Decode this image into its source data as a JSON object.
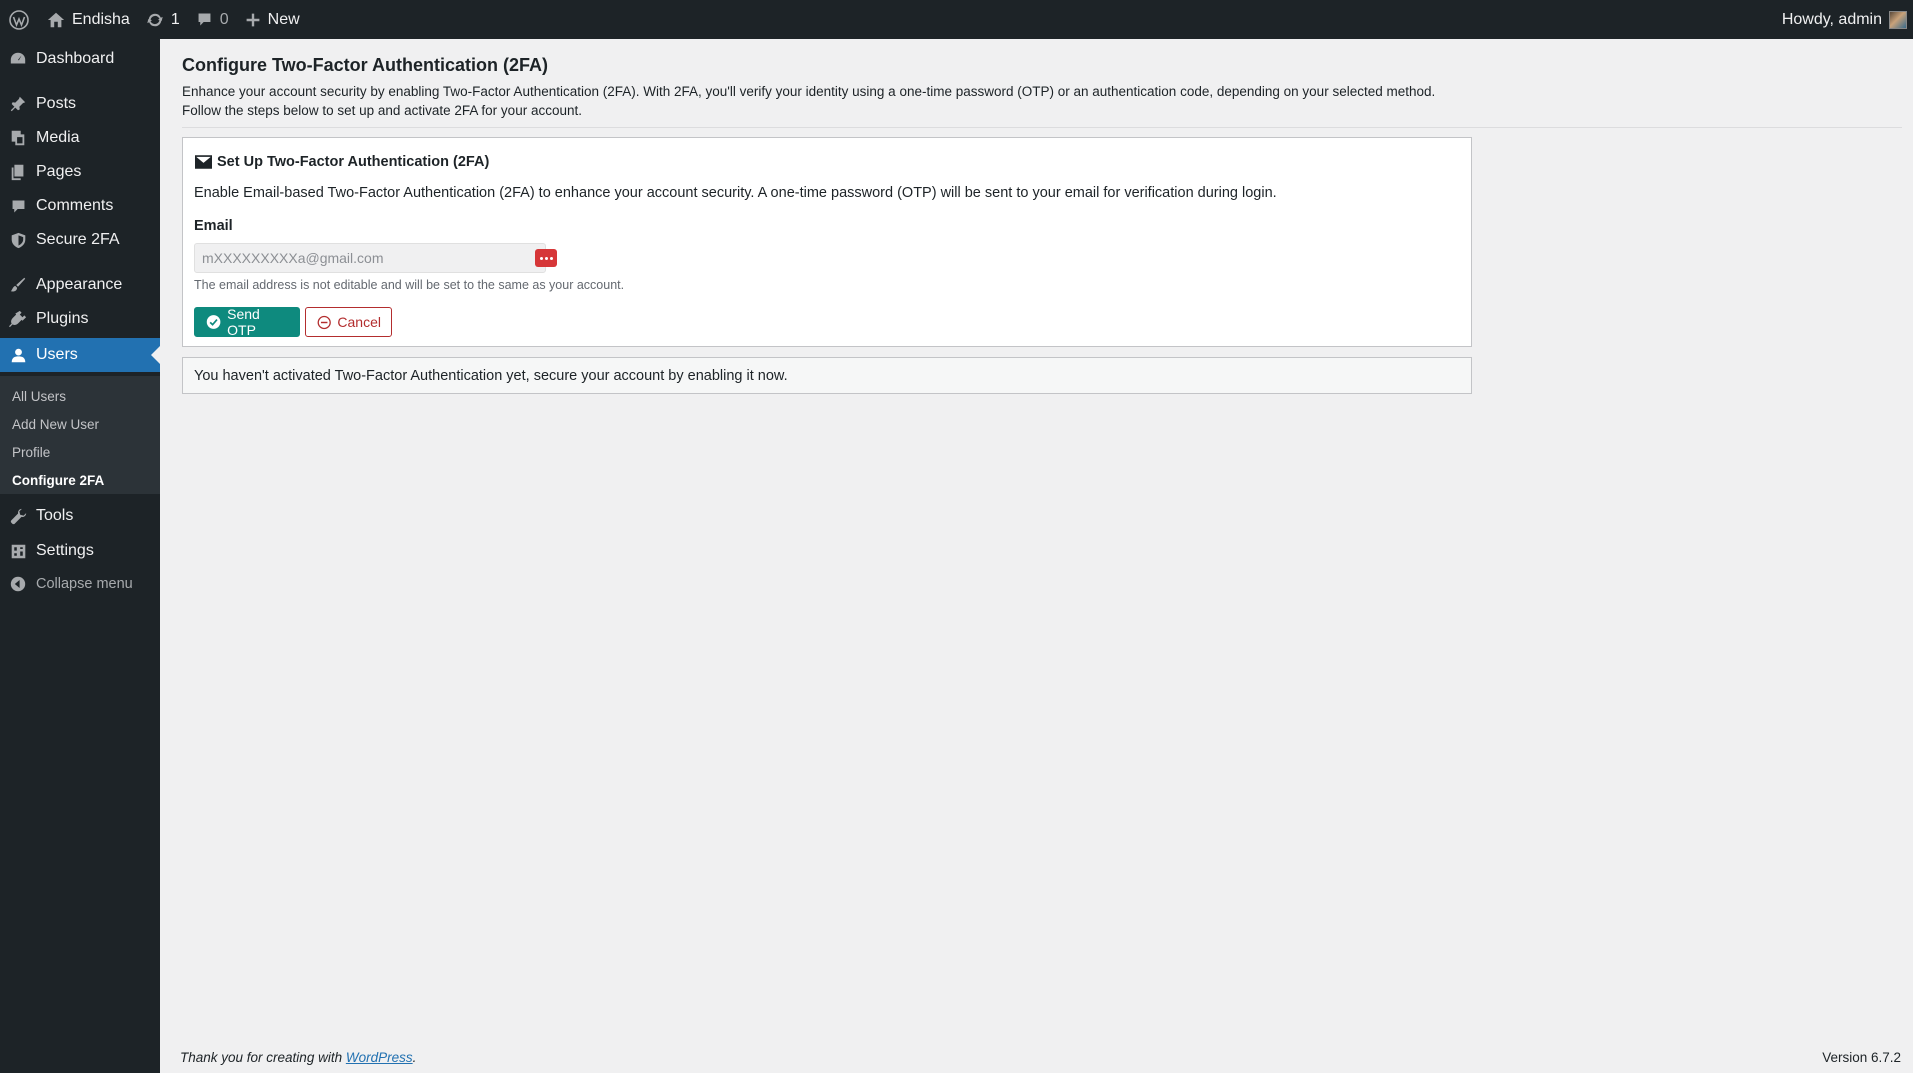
{
  "admin_bar": {
    "site_name": "Endisha",
    "updates_count": "1",
    "comments_count": "0",
    "new_label": "New",
    "greeting": "Howdy, admin"
  },
  "sidebar": {
    "items": [
      {
        "label": "Dashboard",
        "icon": "dashboard-icon"
      },
      {
        "label": "Posts",
        "icon": "pin-icon"
      },
      {
        "label": "Media",
        "icon": "media-icon"
      },
      {
        "label": "Pages",
        "icon": "pages-icon"
      },
      {
        "label": "Comments",
        "icon": "comment-icon"
      },
      {
        "label": "Secure 2FA",
        "icon": "shield-icon"
      },
      {
        "label": "Appearance",
        "icon": "brush-icon"
      },
      {
        "label": "Plugins",
        "icon": "plug-icon"
      },
      {
        "label": "Users",
        "icon": "user-icon"
      },
      {
        "label": "Tools",
        "icon": "wrench-icon"
      },
      {
        "label": "Settings",
        "icon": "settings-icon"
      }
    ],
    "submenu": [
      "All Users",
      "Add New User",
      "Profile",
      "Configure 2FA"
    ],
    "collapse_label": "Collapse menu"
  },
  "main": {
    "title": "Configure Two-Factor Authentication (2FA)",
    "intro_line1": "Enhance your account security by enabling Two-Factor Authentication (2FA). With 2FA, you'll verify your identity using a one-time password (OTP) or an authentication code, depending on your selected method.",
    "intro_line2": "Follow the steps below to set up and activate 2FA for your account.",
    "card": {
      "title": "Set Up Two-Factor Authentication (2FA)",
      "description": "Enable Email-based Two-Factor Authentication (2FA) to enhance your account security. A one-time password (OTP) will be sent to your email for verification during login.",
      "email_label": "Email",
      "email_value": "mXXXXXXXXXa@gmail.com",
      "help_text": "The email address is not editable and will be set to the same as your account.",
      "send_label": "Send OTP",
      "cancel_label": "Cancel"
    },
    "notice": "You haven't activated Two-Factor Authentication yet, secure your account by enabling it now."
  },
  "footer": {
    "thanks_prefix": "Thank you for creating with ",
    "thanks_link": "WordPress",
    "thanks_suffix": ".",
    "version": "Version 6.7.2"
  },
  "colors": {
    "admin_dark": "#1d2327",
    "accent_blue": "#2271b1",
    "send_button": "#0e8a7e",
    "cancel_red": "#b32d2e"
  }
}
